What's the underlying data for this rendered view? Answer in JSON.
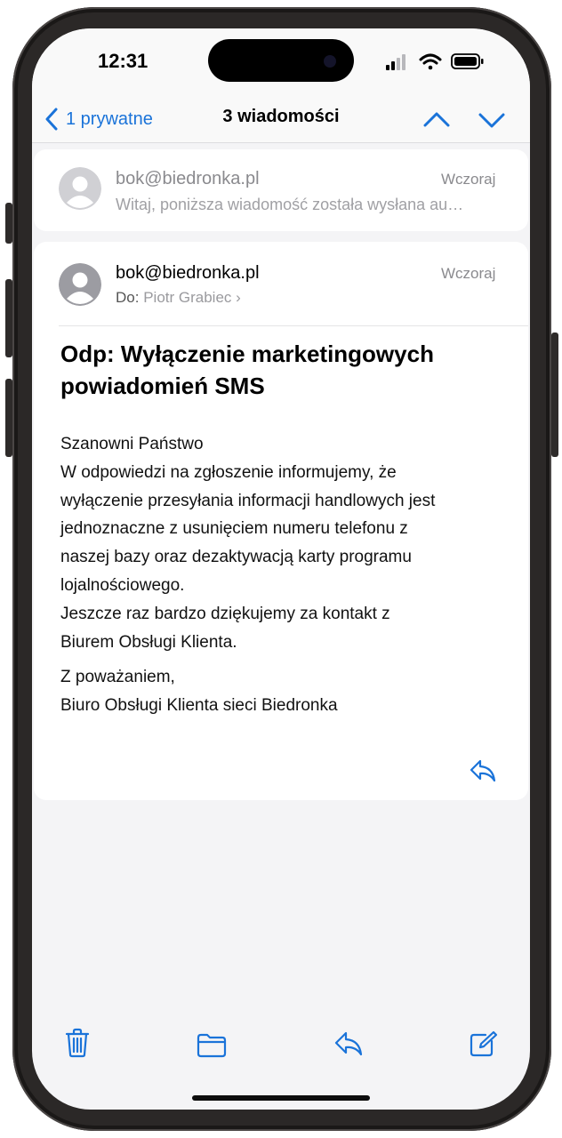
{
  "status": {
    "time": "12:31"
  },
  "nav": {
    "back_label": "1 prywatne",
    "title": "3 wiadomości"
  },
  "collapsed_message": {
    "sender": "bok@biedronka.pl",
    "date": "Wczoraj",
    "preview": "Witaj, poniższa wiadomość została wysłana au…"
  },
  "message": {
    "sender": "bok@biedronka.pl",
    "date": "Wczoraj",
    "to_prefix": "Do:",
    "to_name": "Piotr Grabiec",
    "subject_lines": [
      "Odp: Wyłączenie marketingowych",
      "powiadomień SMS"
    ],
    "body_lines": [
      "Szanowni Państwo",
      "W odpowiedzi na zgłoszenie informujemy, że",
      "wyłączenie przesyłania informacji handlowych jest",
      "jednoznaczne z usunięciem numeru telefonu z",
      "naszej bazy oraz dezaktywacją karty programu",
      "lojalnościowego.",
      "Jeszcze raz bardzo dziękujemy za kontakt z",
      "Biurem Obsługi Klienta."
    ],
    "signature_lines": [
      "Z poważaniem,",
      "Biuro Obsługi Klienta sieci Biedronka"
    ]
  },
  "icons": {
    "back": "chevron-left-icon",
    "prev": "chevron-up-icon",
    "next": "chevron-down-icon",
    "reply": "reply-icon",
    "trash": "trash-icon",
    "folder": "folder-icon",
    "compose": "compose-icon"
  },
  "colors": {
    "accent": "#1a73d9",
    "background": "#f4f4f6",
    "card": "#ffffff"
  }
}
